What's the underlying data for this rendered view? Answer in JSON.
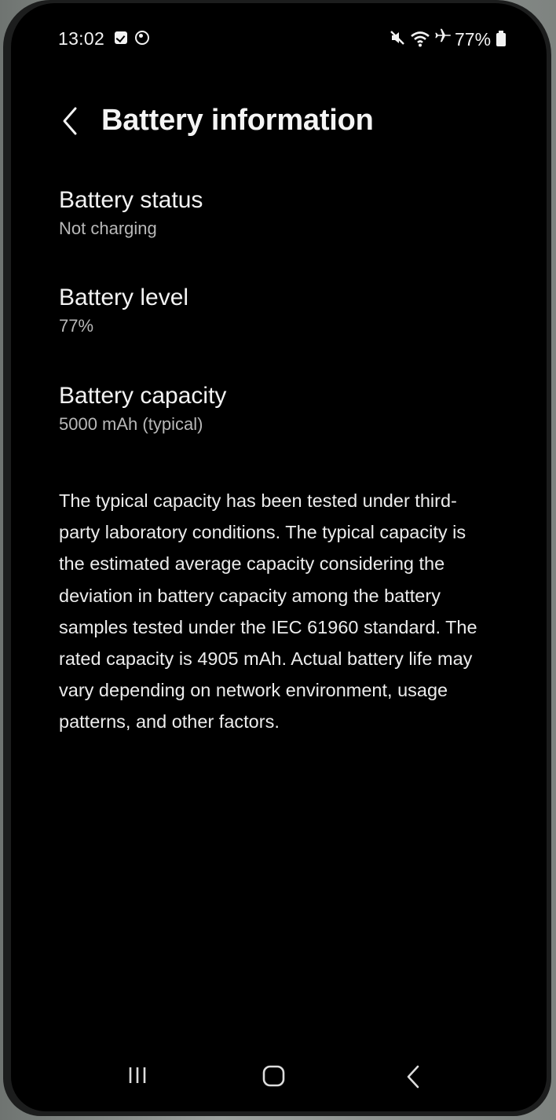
{
  "status_bar": {
    "time": "13:02",
    "battery_percent": "77%",
    "icons": [
      "calendar-check-icon",
      "sync-icon",
      "mute-icon",
      "wifi-icon",
      "airplane-icon",
      "battery-icon"
    ]
  },
  "header": {
    "title": "Battery information",
    "back_icon": "chevron-left-icon"
  },
  "items": [
    {
      "label": "Battery status",
      "value": "Not charging"
    },
    {
      "label": "Battery level",
      "value": "77%"
    },
    {
      "label": "Battery capacity",
      "value": "5000 mAh (typical)"
    }
  ],
  "description": "The typical capacity has been tested under third-party laboratory conditions. The typical capacity is the estimated average capacity considering the deviation in battery capacity among the battery samples tested under the IEC 61960 standard. The rated capacity is 4905 mAh. Actual battery life may vary depending on network environment, usage patterns, and other factors.",
  "nav_bar": {
    "buttons": [
      "recent-apps-icon",
      "home-icon",
      "back-icon"
    ]
  },
  "colors": {
    "background": "#000000",
    "primary_text": "#f3f3f3",
    "secondary_text": "#b8b8b8"
  }
}
